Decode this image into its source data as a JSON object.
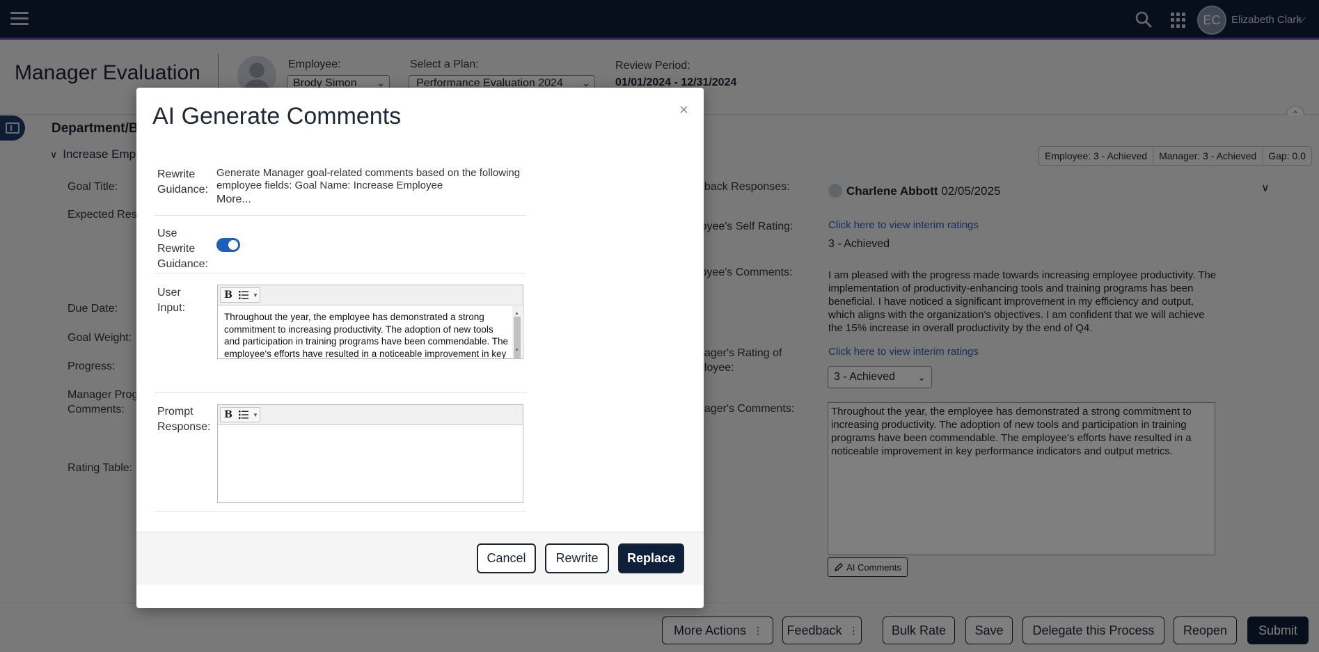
{
  "topbar": {
    "user_initials": "EC",
    "user_name": "Elizabeth Clark"
  },
  "header": {
    "title": "Manager Evaluation",
    "employee_label": "Employee:",
    "employee_value": "Brody Simon",
    "plan_label": "Select a Plan:",
    "plan_value": "Performance Evaluation 2024",
    "review_label": "Review Period:",
    "review_value": "01/01/2024 - 12/31/2024"
  },
  "section": {
    "department_title": "Department/Bu",
    "goal_heading": "Increase Empl",
    "left_labels": {
      "goal_title": "Goal Title:",
      "expected": "Expected Resu",
      "due_date": "Due Date:",
      "goal_weight": "Goal Weight:",
      "progress": "Progress:",
      "mgr_prog_1": "Manager Prog",
      "mgr_prog_2": "Comments:",
      "rating_table": "Rating Table:"
    }
  },
  "scores": {
    "employee": "Employee: 3 - Achieved",
    "manager": "Manager: 3 - Achieved",
    "gap": "Gap: 0.0"
  },
  "right": {
    "feedback_label": "dback Responses:",
    "feedback_person": "Charlene Abbott",
    "feedback_date": "02/05/2025",
    "self_rating_label": "loyee's Self Rating:",
    "interim_link": "Click here to view interim ratings",
    "self_rating_value": "3 - Achieved",
    "emp_comments_label": "loyee's Comments:",
    "emp_comments": "I am pleased with the progress made towards increasing employee productivity. The implementation of productivity-enhancing tools and training programs has been beneficial. I have noticed a significant improvement in my efficiency and output, which aligns with the organization's objectives. I am confident that we will achieve the 15% increase in overall productivity by the end of Q4.",
    "mgr_rating_label_1": "nager's Rating of",
    "mgr_rating_label_2": "ployee:",
    "mgr_interim_link": "Click here to view interim ratings",
    "mgr_rating_value": "3 - Achieved",
    "mgr_comments_label": "nager's Comments:",
    "mgr_comments": "Throughout the year, the employee has demonstrated a strong commitment to increasing productivity. The adoption of new tools and participation in training programs have been commendable. The employee's efforts have resulted in a noticeable improvement in key performance indicators and output metrics.",
    "ai_button": "AI Comments"
  },
  "footer": {
    "more_actions": "More Actions",
    "feedback": "Feedback",
    "bulk_rate": "Bulk Rate",
    "save": "Save",
    "delegate": "Delegate this Process",
    "reopen": "Reopen",
    "submit": "Submit"
  },
  "modal": {
    "title": "AI Generate Comments",
    "close": "×",
    "rewrite_guidance_label_1": "Rewrite",
    "rewrite_guidance_label_2": "Guidance:",
    "rewrite_guidance_text": "Generate Manager goal-related comments based on the following employee fields: Goal Name: Increase Employee",
    "more": "More...",
    "use_rewrite_label_1": "Use",
    "use_rewrite_label_2": "Rewrite",
    "use_rewrite_label_3": "Guidance:",
    "user_input_label_1": "User",
    "user_input_label_2": "Input:",
    "user_input_text": "Throughout the year, the employee has demonstrated a strong commitment to increasing productivity. The adoption of new tools and participation in training programs have been commendable. The employee's efforts have resulted in a noticeable improvement in key performance indicators and output metrics.",
    "prompt_label_1": "Prompt",
    "prompt_label_2": "Response:",
    "prompt_text": "",
    "cancel": "Cancel",
    "rewrite": "Rewrite",
    "replace": "Replace"
  }
}
